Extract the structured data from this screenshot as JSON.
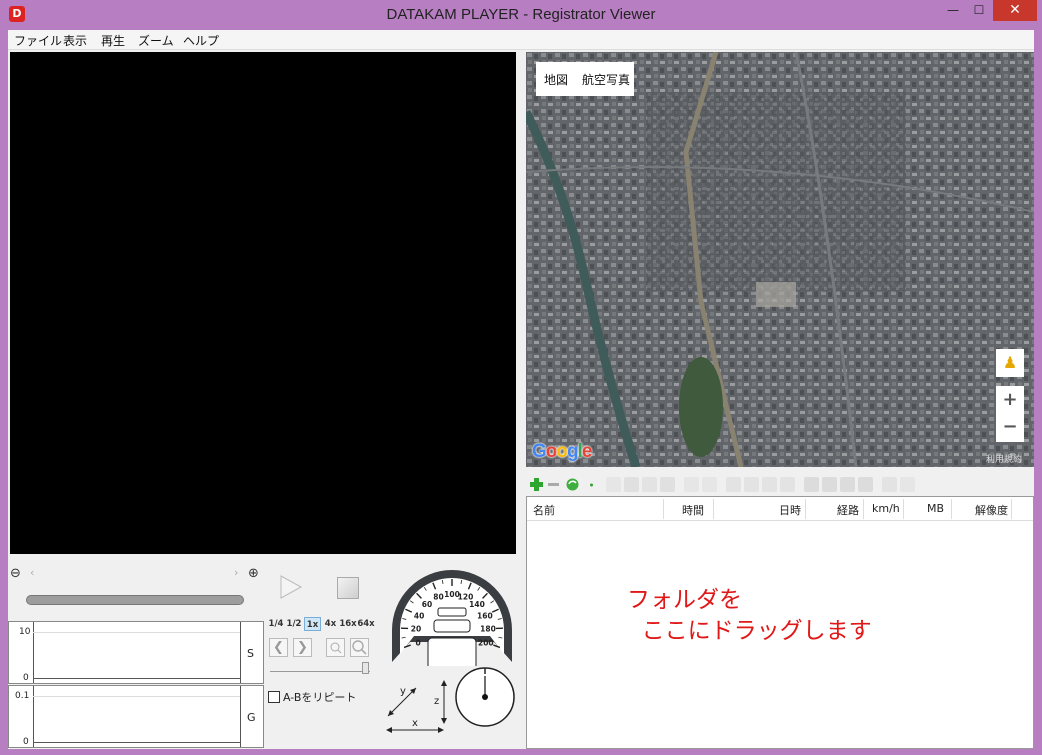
{
  "window": {
    "title": "DATAKAM PLAYER - Registrator Viewer",
    "app_icon": "D",
    "minimize": "—",
    "maximize": "☐",
    "close": "✕"
  },
  "menu": [
    "ファイル",
    "表示",
    "再生",
    "ズーム",
    "ヘルプ"
  ],
  "player": {
    "speeds": [
      "1/4",
      "1/2",
      "1x",
      "4x",
      "16x",
      "64x"
    ],
    "active_speed": "1x",
    "ab_repeat_label": "A-Bをリピート",
    "zoom_out": "⊖",
    "zoom_in": "⊕",
    "prev": "❮",
    "next": "❯",
    "seek_left": "‹",
    "seek_right": "›"
  },
  "graphs": {
    "speed": {
      "name": "S",
      "max_label": "10",
      "min_label": "0"
    },
    "gforce": {
      "name": "G",
      "max_label": "0.1",
      "min_label": "0"
    }
  },
  "speedometer": {
    "ticks": [
      "0",
      "20",
      "40",
      "60",
      "80",
      "100",
      "120",
      "140",
      "160",
      "180",
      "200"
    ]
  },
  "axes": {
    "x": "x",
    "y": "y",
    "z": "z"
  },
  "map": {
    "type_options": [
      "地図",
      "航空写真"
    ],
    "selected_type": "航空写真",
    "zoom_plus": "+",
    "zoom_minus": "−",
    "pegman": "♟",
    "logo_letters": [
      "G",
      "o",
      "o",
      "g",
      "l",
      "e"
    ],
    "logo_colors": [
      "#4285f4",
      "#ea4335",
      "#fbbc05",
      "#4285f4",
      "#34a853",
      "#ea4335"
    ],
    "terms": "利用規約"
  },
  "file_list": {
    "columns": [
      "名前",
      "時間",
      "日時",
      "経路",
      "km/h",
      "MB",
      "解像度"
    ],
    "drop_hint": "フォルダを\n  ここにドラッグします"
  },
  "colors": {
    "frame": "#b77fc2",
    "close_button": "#c7372b",
    "drop_hint": "#e01818"
  }
}
